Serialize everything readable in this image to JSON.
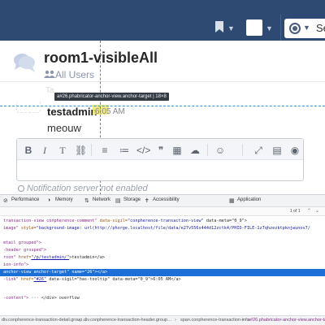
{
  "app": {
    "nav_search_label": "Se"
  },
  "room": {
    "title": "room1-visibleAll",
    "subtitle": "All Users",
    "hidden_caption": "Ta"
  },
  "inspector": {
    "tooltip": "a#26.phabricator-anchor-view.anchor-target | 18×8"
  },
  "comment": {
    "author": "testadmin",
    "time": "6:05 AM",
    "message": "meouw"
  },
  "editor": {
    "toolbar_buttons": [
      {
        "label": "B",
        "icon": "bold-icon"
      },
      {
        "label": "I",
        "icon": "italic-icon"
      },
      {
        "label": "T",
        "icon": "monospace-icon"
      },
      {
        "label": "⛓",
        "icon": "link-icon"
      },
      {
        "label": "≡",
        "icon": "bulleted-list-icon"
      },
      {
        "label": "≔",
        "icon": "numbered-list-icon"
      },
      {
        "label": "</>",
        "icon": "code-icon"
      },
      {
        "label": "❞",
        "icon": "quote-icon"
      },
      {
        "label": "▦",
        "icon": "table-icon"
      },
      {
        "label": "☁",
        "icon": "upload-icon"
      },
      {
        "label": "☺",
        "icon": "emoji-icon"
      },
      {
        "label": "⤢",
        "icon": "fullscreen-icon"
      },
      {
        "label": "▤",
        "icon": "remarkup-help-icon"
      },
      {
        "label": "◉",
        "icon": "preview-icon"
      }
    ]
  },
  "notification": "Notification server not enabled",
  "devtools": {
    "tabs": [
      {
        "icon": "⊘",
        "label": "Performance"
      },
      {
        "icon": "◑",
        "label": "Memory"
      },
      {
        "icon": "⇅",
        "label": "Network"
      },
      {
        "icon": "▤",
        "label": "Storage"
      },
      {
        "icon": "✝",
        "label": "Accessibility"
      },
      {
        "icon": "▦",
        "label": "Application"
      }
    ],
    "find_count": "1 of 1",
    "code_lines": [
      {
        "pre": "",
        "tag": "transaction-view conpherence-comment",
        "at": "\" data-sigil=",
        "av": "\"conpherence-transaction-view\"",
        "post": " data-meta=\"0_9\">"
      },
      {
        "pre": "",
        "tag": "image\"",
        "at": " style=",
        "av": "\"background-image: url(http://phorge.localhost/file/data/e27v556s444d12zctk4/PHID-FILE-1z7qhzezktpknjwunov7/",
        "post": ""
      },
      {
        "pre": "",
        "tag": "",
        "at": "",
        "av": "",
        "post": ""
      },
      {
        "pre": "",
        "tag": "etail grouped\">",
        "at": "",
        "av": "",
        "post": ""
      },
      {
        "pre": "",
        "tag": "-header grouped\">",
        "at": "",
        "av": "",
        "post": ""
      },
      {
        "pre": "",
        "tag": "rson\"",
        "at": " href=",
        "av": "\"/p/testadmin/\"",
        "post": ">testadmin</a>"
      },
      {
        "pre": "",
        "tag": "ion-info\">",
        "at": "",
        "av": "",
        "post": ""
      },
      {
        "pre": "",
        "tag": "anchor-view anchor-target\"",
        "at": " name=",
        "av": "\"26\"",
        "post": "></a>"
      },
      {
        "pre": "",
        "tag": "-link\"",
        "at": " href=",
        "av": "\"#26\"",
        "post": " data-sigil=\"has-tooltip\" data-meta=\"0_9\">6:05 AM</a>"
      },
      {
        "pre": "",
        "tag": "",
        "at": "",
        "av": "",
        "post": ""
      },
      {
        "pre": "",
        "tag": "",
        "at": "",
        "av": "",
        "post": ""
      },
      {
        "pre": "",
        "tag": "",
        "at": "",
        "av": "",
        "post": ""
      },
      {
        "pre": "",
        "tag": "",
        "at": "",
        "av": "",
        "post": ""
      },
      {
        "pre": "",
        "tag": "-content\">",
        "at": "",
        "av": "",
        "post": " ··· </div> overflow"
      }
    ],
    "selected_line": 7,
    "breadcrumbs": [
      "div.conpherence-transaction-detail.group…",
      "div.conpherence-transaction-header.group…",
      "span.conpherence-transaction-info",
      "a#26.phabricator-anchor-view.anchor-targ…"
    ]
  },
  "colors": {
    "nav_bg": "#2f4a72",
    "selection": "#1b6fd6",
    "inspector_highlight": "#eee86e"
  }
}
